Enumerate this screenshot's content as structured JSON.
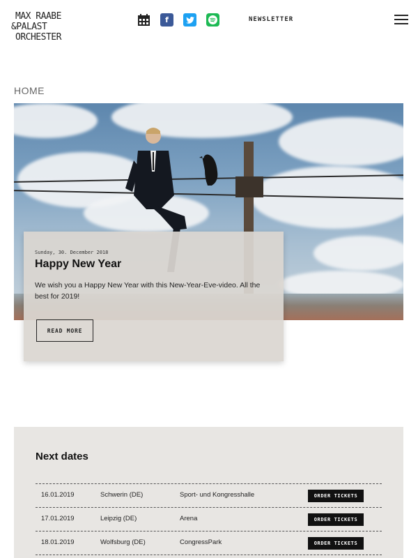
{
  "header": {
    "logo_line1": "MAX RAABE",
    "logo_line2": "&PALAST",
    "logo_line3": "ORCHESTER",
    "icons": [
      "calendar-icon",
      "facebook-icon",
      "twitter-icon",
      "spotify-icon"
    ],
    "newsletter_label": "NEWSLETTER",
    "menu_icon": "hamburger-menu-icon"
  },
  "breadcrumb": "HOME",
  "hero": {
    "image_alt": "man in suit sitting on power line with crow",
    "card": {
      "date": "Sunday, 30. December 2018",
      "title": "Happy New Year",
      "text": "We wish you a Happy New Year with this New-Year-Eve-video. All the best for 2019!",
      "button_label": "READ MORE"
    }
  },
  "next_dates": {
    "title": "Next dates",
    "button_label": "ORDER TICKETS",
    "rows": [
      {
        "date": "16.01.2019",
        "city": "Schwerin (DE)",
        "venue": "Sport- und Kongresshalle"
      },
      {
        "date": "17.01.2019",
        "city": "Leipzig (DE)",
        "venue": "Arena"
      },
      {
        "date": "18.01.2019",
        "city": "Wolfsburg (DE)",
        "venue": "CongressPark"
      }
    ]
  },
  "colors": {
    "facebook": "#3b5998",
    "twitter": "#1da1f2",
    "spotify": "#1db954",
    "card_bg": "#dad6d1",
    "dates_bg": "#e8e6e3"
  }
}
